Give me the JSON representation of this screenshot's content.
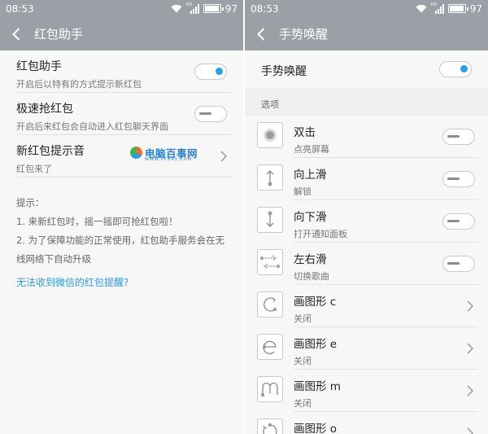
{
  "left": {
    "status": {
      "time": "08:53",
      "battery": "97",
      "battery_fill": 0.97,
      "net": "HD"
    },
    "title": "红包助手",
    "settings": [
      {
        "title": "红包助手",
        "subtitle": "开启后以特有的方式提示新红包",
        "control": "toggle",
        "on": true
      },
      {
        "title": "极速抢红包",
        "subtitle": "开启后来红包会自动进入红包聊天界面",
        "control": "toggle",
        "on": false
      },
      {
        "title": "新红包提示音",
        "subtitle": "红包来了",
        "control": "chevron"
      }
    ],
    "tips": {
      "heading": "提示：",
      "line1": "1. 来新红包时，摇一摇即可抢红包啦！",
      "line2": "2. 为了保障功能的正常使用，红包助手服务会在无线网络下自动升级"
    },
    "link": "无法收到微信的红包提醒?",
    "watermark": {
      "text": "电脑百事网",
      "url": "WWW.PC841.COM"
    }
  },
  "right": {
    "status": {
      "time": "08:53",
      "battery": "97",
      "battery_fill": 0.97,
      "net": "HD"
    },
    "title": "手势唤醒",
    "master": {
      "title": "手势唤醒",
      "on": true
    },
    "section": "选项",
    "gestures": [
      {
        "icon": "double-tap-icon",
        "title": "双击",
        "subtitle": "点亮屏幕",
        "control": "toggle",
        "on": false
      },
      {
        "icon": "swipe-up-icon",
        "title": "向上滑",
        "subtitle": "解锁",
        "control": "toggle",
        "on": false
      },
      {
        "icon": "swipe-down-icon",
        "title": "向下滑",
        "subtitle": "打开通知面板",
        "control": "toggle",
        "on": false
      },
      {
        "icon": "swipe-left-right-icon",
        "title": "左右滑",
        "subtitle": "切换歌曲",
        "control": "toggle",
        "on": false
      },
      {
        "icon": "draw-c-icon",
        "title": "画图形 c",
        "subtitle": "关闭",
        "control": "chevron"
      },
      {
        "icon": "draw-e-icon",
        "title": "画图形 e",
        "subtitle": "关闭",
        "control": "chevron"
      },
      {
        "icon": "draw-m-icon",
        "title": "画图形 m",
        "subtitle": "关闭",
        "control": "chevron"
      },
      {
        "icon": "draw-o-icon",
        "title": "画图形 o",
        "subtitle": "",
        "control": "chevron"
      }
    ]
  },
  "colors": {
    "accent": "#2aa0e8",
    "appbar": "#9aa0a6",
    "link": "#3296de"
  }
}
